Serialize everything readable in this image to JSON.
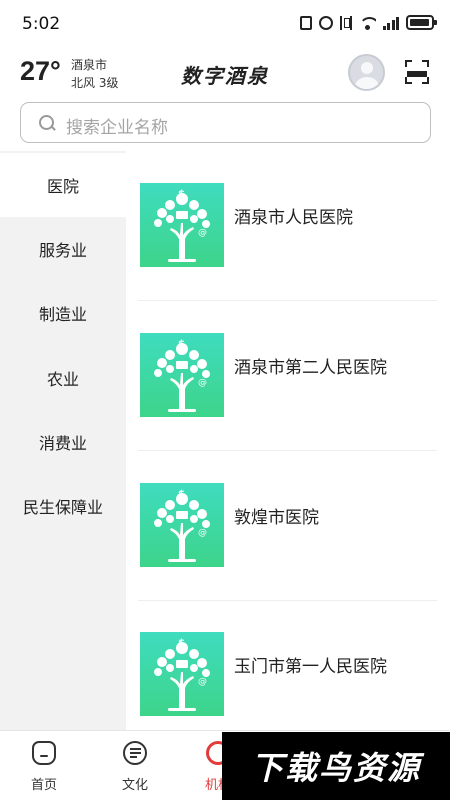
{
  "status_bar": {
    "time": "5:02"
  },
  "weather": {
    "temperature": "27°",
    "city": "酒泉市",
    "wind": "北风 3级"
  },
  "header": {
    "title": "数字酒泉"
  },
  "search": {
    "placeholder": "搜索企业名称"
  },
  "categories": [
    {
      "label": "医院",
      "active": true
    },
    {
      "label": "服务业",
      "active": false
    },
    {
      "label": "制造业",
      "active": false
    },
    {
      "label": "农业",
      "active": false
    },
    {
      "label": "消费业",
      "active": false
    },
    {
      "label": "民生保障业",
      "active": false
    }
  ],
  "list": [
    {
      "name": "酒泉市人民医院"
    },
    {
      "name": "酒泉市第二人民医院"
    },
    {
      "name": "敦煌市医院"
    },
    {
      "name": "玉门市第一人民医院"
    }
  ],
  "bottom_nav": [
    {
      "label": "首页",
      "icon": "home-icon"
    },
    {
      "label": "文化",
      "icon": "culture-icon"
    },
    {
      "label": "机构",
      "icon": "org-icon"
    }
  ],
  "watermark": {
    "text": "下载鸟资源"
  },
  "colors": {
    "thumb_top": "#3fdcbf",
    "thumb_bottom": "#3dd48a",
    "active_nav": "#e23b3b",
    "sidebar_bg": "#f2f2f2"
  }
}
